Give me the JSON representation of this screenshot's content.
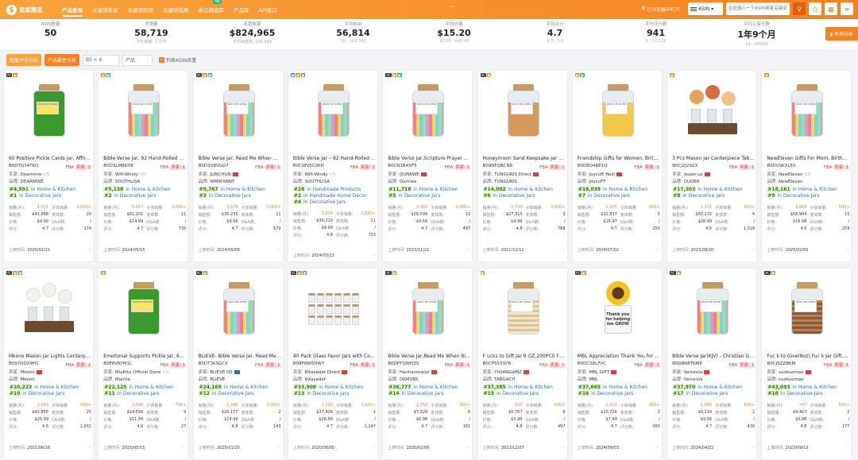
{
  "header": {
    "logo_text": "卖家精灵",
    "logo_mark": "S",
    "nav": [
      {
        "label": "产品查询",
        "active": true
      },
      {
        "label": "关键词反查"
      },
      {
        "label": "关键词挖掘"
      },
      {
        "label": "关键词拓展"
      },
      {
        "label": "新品精选库",
        "badge": "NE"
      },
      {
        "label": "产品库"
      },
      {
        "label": "API接口"
      }
    ],
    "open_browser": "在浏览器中打开",
    "asin_select": "ASIN",
    "search_placeholder": "在此输入一个ASIN或者关键词..."
  },
  "stats": [
    {
      "label": "ASIN数量",
      "value": "50",
      "sub": ""
    },
    {
      "label": "总销量",
      "value": "58,719",
      "sub": "平均销量: 1,174"
    },
    {
      "label": "总销售额",
      "value": "$824,965",
      "sub": "平均销售额: $16,499"
    },
    {
      "label": "平均BSR",
      "value": "56,814",
      "sub": "26 - 103,343"
    },
    {
      "label": "平均价格",
      "value": "$15.20",
      "sub": "$5.00 - $48.99"
    },
    {
      "label": "平均评分",
      "value": "4.7",
      "sub": "4.3 - 5.0"
    },
    {
      "label": "平均评分数",
      "value": "941",
      "sub": "6 - 27,131"
    },
    {
      "label": "平均上架天数",
      "value": "1年9个月",
      "sub": "14 - 4866天"
    }
  ],
  "market_button": "市场分析",
  "filters": {
    "btn_reviews": "批量评论分析",
    "btn_attributes": "产品属性分析",
    "bs_select": "BS × 6",
    "sort_select": "产品",
    "checkbox_label": "列表ASIN去重",
    "checkbox_mark": "✓"
  },
  "labels": {
    "fba": "FBA",
    "fba_mark": "卖家: 1",
    "seller": "卖家: ",
    "brand": "品牌: ",
    "units": "销量(月): ",
    "sub_units": "子体销量: ",
    "revenue": "销售额: ",
    "variations": "变体数: ",
    "price": "价格: ",
    "qa": "Q&A数: ",
    "rating": "评分: ",
    "ratings": "评分数: ",
    "listed": "上架时间: ",
    "more": "···",
    "in": " in "
  },
  "products": [
    {
      "tags": [
        "AC",
        "o"
      ],
      "title": "60 Positive Pickle Cards Jar, Affirmation...",
      "asin": "B0DTQ34TKQ",
      "seller": "Dearmine",
      "seller_cn": "VN",
      "brand": "DEARMINE",
      "rank1": "#4,591",
      "cat1": "Home & Kitchen",
      "rank2": "#1",
      "cat2": "Decorative Jars",
      "units": "4,171",
      "sub_units": "3,000+",
      "revenue": "$41,668",
      "variations": "20",
      "price": "$9.99",
      "qa": "/",
      "rating": "4.7",
      "ratings": "174",
      "listed": "2025/01/21",
      "img": "pickle"
    },
    {
      "tags": [
        "o",
        "g"
      ],
      "title": "Bible Verse Jar, 92 Hand-Rolled Scripture",
      "asin": "B0D3LM8KH8",
      "seller": "Wifi-Windy",
      "seller_cn": "VN",
      "brand": "SOUTHLISA",
      "rank1": "#5,158",
      "cat1": "Home & Kitchen",
      "rank2": "#2",
      "cat2": "Decorative Jars",
      "units": "5,417",
      "sub_units": "3,000+",
      "revenue": "$81,201",
      "variations": "11",
      "price": "$14.99",
      "qa": "/",
      "rating": "4.7",
      "ratings": "735",
      "listed": "2024/05/15",
      "img": "rainbow"
    },
    {
      "tags": [
        "AC",
        "o",
        "g"
      ],
      "title": "Bible Verse Jar, Read Me When Bible Verses",
      "asin": "B0D3VBVGG7",
      "seller": "JLINCHUN",
      "seller_cn": "CN",
      "brand": "WMWXNNT",
      "rank1": "#9,767",
      "cat1": "Home & Kitchen",
      "rank2": "#3",
      "cat2": "Decorative Jars",
      "units": "3,678",
      "sub_units": "2,000+",
      "revenue": "$35,235",
      "variations": "11",
      "price": "$9.58",
      "qa": "/",
      "rating": "4.7",
      "ratings": "679",
      "listed": "2024/06/09",
      "img": "rainbow"
    },
    {
      "tags": [
        "b",
        "o",
        "g"
      ],
      "title": "Bible Verse Jar – 92 Hand-Rolled Scripture",
      "asin": "B0CWV5C3KH",
      "seller": "Wifi-Windy",
      "seller_cn": "VN",
      "brand": "SOUTHLISA",
      "rank1": "#26",
      "cat1": "Handmade Products",
      "rank2": "#2",
      "cat2": "Handmade Home Décor",
      "rank3": "#4",
      "cat3": "Decorative Jars",
      "units": "3,024",
      "sub_units": "2,000+",
      "revenue": "$30,210",
      "variations": "11",
      "price": "$9.99",
      "qa": "/",
      "rating": "4.8",
      "ratings": "723",
      "listed": "2024/03/13",
      "img": "rainbow"
    },
    {
      "tags": [
        "AC",
        "o",
        "g"
      ],
      "title": "Bible Verse Jar,Scripture Prayer Cards",
      "asin": "B0CN1B4XF5",
      "seller": "QUNRWE",
      "seller_cn": "CN",
      "brand": "Qunrwe",
      "rank1": "#11,718",
      "cat1": "Home & Kitchen",
      "rank2": "#5",
      "cat2": "Decorative Jars",
      "units": "2,991",
      "sub_units": "2,000+",
      "revenue": "$28,594",
      "variations": "11",
      "price": "$9.56",
      "qa": "/",
      "rating": "4.7",
      "ratings": "497",
      "listed": "2023/11/21",
      "img": "rainbow"
    },
    {
      "tags": [
        "AC",
        "o"
      ],
      "title": "Honeymoon Sand Keepsake Jar Wedding",
      "asin": "B09NFQBCNR",
      "seller": "TUNGURIS Direct",
      "seller_cn": "CN",
      "brand": "TUNGURIS",
      "rank1": "#14,002",
      "cat1": "Home & Kitchen",
      "rank2": "#6",
      "cat2": "Decorative Jars",
      "units": "2,734",
      "sub_units": "2,000+",
      "revenue": "$27,313",
      "variations": "3",
      "price": "$9.99",
      "qa": "/",
      "rating": "4.8",
      "ratings": "789",
      "listed": "2021/12/11",
      "img": "honey"
    },
    {
      "tags": [
        "o",
        "g"
      ],
      "title": "Friendship Gifts for Women, Birthday Gifts",
      "asin": "B0D8Q4BP1Q",
      "seller": "Joycuff Yaoli",
      "seller_cn": "CN",
      "brand": "JoycuFF",
      "rank1": "#16,039",
      "cat1": "Home & Kitchen",
      "rank2": "#7",
      "cat2": "Decorative Jars",
      "units": "1,935",
      "sub_units": "900+",
      "revenue": "$32,837",
      "variations": "5",
      "price": "$16.97",
      "qa": "/",
      "rating": "4.7",
      "ratings": "250",
      "listed": "2024/07/02",
      "img": "gold"
    },
    {
      "tags": [
        "o"
      ],
      "title": "3 Pcs Mason Jar Centerpiece Table Decor",
      "asin": "B0CJ2J29ZX",
      "seller": "duoer-us",
      "seller_cn": "CN",
      "brand": "DUOER",
      "rank1": "#17,303",
      "cat1": "Home & Kitchen",
      "rank2": "#8",
      "cat2": "Decorative Jars",
      "units": "2,231",
      "sub_units": "900+",
      "revenue": "$60,215",
      "variations": "4",
      "price": "$26.99",
      "qa": "/",
      "rating": "4.5",
      "ratings": "1,018",
      "listed": "2023/09/20",
      "img": "flower"
    },
    {
      "tags": [
        "o"
      ],
      "title": "NewEleven Gifts For Mom, Birthday Gifts",
      "asin": "B0DVSKXL5S",
      "seller": "NewEleven",
      "seller_cn": "VN",
      "brand": "NewEleven",
      "rank1": "#18,161",
      "cat1": "Home & Kitchen",
      "rank2": "#9",
      "cat2": "Decorative Jars",
      "units": "3,469",
      "sub_units": "500+",
      "revenue": "$58,904",
      "variations": "15",
      "price": "$16.98",
      "qa": "/",
      "rating": "4.6",
      "ratings": "259",
      "listed": "2025/02/02",
      "img": "rainbow"
    },
    {
      "tags": [
        "AC",
        "o",
        "g"
      ],
      "title": "Mkono Mason Jar Lights Centerpiece Table",
      "asin": "B097DQX9H1",
      "seller": "Mkono",
      "seller_cn": "CN",
      "brand": "Mkono",
      "rank1": "#20,223",
      "cat1": "Home & Kitchen",
      "rank2": "#10",
      "cat2": "Decorative Jars",
      "units": "1,649",
      "sub_units": "600+",
      "revenue": "$42,858",
      "variations": "25",
      "price": "$25.99",
      "qa": "/",
      "rating": "4.6",
      "ratings": "1,932",
      "listed": "2021/06/16",
      "img": "flowerw"
    },
    {
      "tags": [
        "o"
      ],
      "title": "Emotional Supports Pickle Jar, 60 Positive",
      "asin": "B0F8VRYM1L",
      "seller": "MiaRita Official Store",
      "seller_cn": "VN",
      "brand": "Miarita",
      "rank1": "#22,125",
      "cat1": "Home & Kitchen",
      "rank2": "#11",
      "cat2": "Decorative Jars",
      "units": "2,048",
      "sub_units": "700+",
      "revenue": "$24,556",
      "variations": "9",
      "price": "$11.99",
      "qa": "/",
      "rating": "4.6",
      "ratings": "27",
      "listed": "2025/05/15",
      "img": "pickle"
    },
    {
      "tags": [
        "AC",
        "o"
      ],
      "title": "BLIEVE- Bible Verse Jar, Read Me When",
      "asin": "B0DT3KSGCX",
      "seller": "BLIEVE US",
      "seller_cn": "US",
      "brand": "BLIEVE",
      "rank1": "#24,169",
      "cat1": "Home & Kitchen",
      "rank2": "#12",
      "cat2": "Decorative Jars",
      "units": "1,346",
      "sub_units": "2,000+",
      "revenue": "$20,177",
      "variations": "2",
      "price": "$14.99",
      "qa": "/",
      "rating": "4.8",
      "ratings": "143",
      "listed": "2025/01/20",
      "img": "rainbow"
    },
    {
      "tags": [
        "AC",
        "o",
        "g"
      ],
      "title": "40 Pack Glass Favor Jars with Cork Lids",
      "asin": "B08F8WSHWY",
      "seller": "Ritayedet Direct",
      "seller_cn": "CN",
      "brand": "Ritayedet",
      "rank1": "#33,908",
      "cat1": "Home & Kitchen",
      "rank2": "#13",
      "cat2": "Decorative Jars",
      "units": "1,293",
      "sub_units": "1,000+",
      "revenue": "$37,426",
      "variations": "1",
      "price": "$28.99",
      "qa": "/",
      "rating": "4.7",
      "ratings": "1,147",
      "listed": "2020/08/05",
      "img": "mini"
    },
    {
      "tags": [
        "AC",
        "o"
      ],
      "title": "Bible Verse Jar,Read Me When Bible Verses",
      "asin": "B0DPTQWHZS",
      "seller": "Hanhanmaozi",
      "seller_cn": "CN",
      "brand": "OKMXBS",
      "rank1": "#36,777",
      "cat1": "Home & Kitchen",
      "rank2": "#14",
      "cat2": "Decorative Jars",
      "units": "1,050",
      "sub_units": "900+",
      "revenue": "$7,329",
      "variations": "6",
      "price": "$6.98",
      "qa": "/",
      "rating": "4.7",
      "ratings": "161",
      "listed": "2025/02/06",
      "img": "rainbow"
    },
    {
      "tags": [
        "o"
      ],
      "title": "F ucks to Gift Jar 9 OZ,200PCS Funny",
      "asin": "B0CPS5XSYR",
      "seller": "YIXIANGAMZ",
      "seller_cn": "CN",
      "brand": "TABGACH",
      "rank1": "#37,385",
      "cat1": "Home & Kitchen",
      "rank2": "#15",
      "cat2": "Decorative Jars",
      "units": "825",
      "sub_units": "600+",
      "revenue": "$5,767",
      "variations": "6",
      "price": "$5.99",
      "qa": "/",
      "rating": "4.8",
      "ratings": "497",
      "listed": "2023/12/07",
      "img": "cream"
    },
    {
      "tags": [
        "AC",
        "o"
      ],
      "title": "MBL Appreciation Thank You for Helping",
      "asin": "B0DCS8LFVC",
      "seller": "MBL GIFT",
      "seller_cn": "CN",
      "brand": "MBL",
      "rank1": "#37,665",
      "cat1": "Home & Kitchen",
      "rank2": "#16",
      "cat2": "Decorative Jars",
      "units": "1,432",
      "sub_units": "900+",
      "revenue": "$10,726",
      "variations": "2",
      "price": "$7.49",
      "qa": "/",
      "rating": "4.7",
      "ratings": "260",
      "listed": "2024/09/03",
      "img": "sunflower"
    },
    {
      "tags": [
        "AC",
        "o"
      ],
      "title": "Bible Verse Jar(KJV) - Christian Gifts",
      "asin": "B0D8N6TKM8",
      "seller": "Sensrola",
      "seller_cn": "CN",
      "brand": "Sensrola",
      "rank1": "#37,970",
      "cat1": "Home & Kitchen",
      "rank2": "#17",
      "cat2": "Decorative Jars",
      "units": "1,040",
      "sub_units": "600+",
      "revenue": "$9,214",
      "variations": "2",
      "price": "$9.56",
      "qa": "/",
      "rating": "4.7",
      "ratings": "439",
      "listed": "2024/04/22",
      "img": "rainbow"
    },
    {
      "tags": [
        "AC",
        "o"
      ],
      "title": "Fuc k to Give(8oz),Fuc k Jar Gift, Funny",
      "asin": "B0CJSZZBKM",
      "seller": "suokuomax",
      "seller_cn": "CN",
      "brand": "suokuomax",
      "rank1": "#43,093",
      "cat1": "Home & Kitchen",
      "rank2": "#18",
      "cat2": "Decorative Jars",
      "units": "747",
      "sub_units": "600+",
      "revenue": "$4,467",
      "variations": "2",
      "price": "$5.98",
      "qa": "/",
      "rating": "4.8",
      "ratings": "177",
      "listed": "2023/09/13",
      "img": "brown"
    }
  ],
  "sunflower_text": "Thank you for helping me GROW",
  "pickle_text": "POSITIVE PICKLE",
  "jar_label_text": "READ ME WHEN"
}
